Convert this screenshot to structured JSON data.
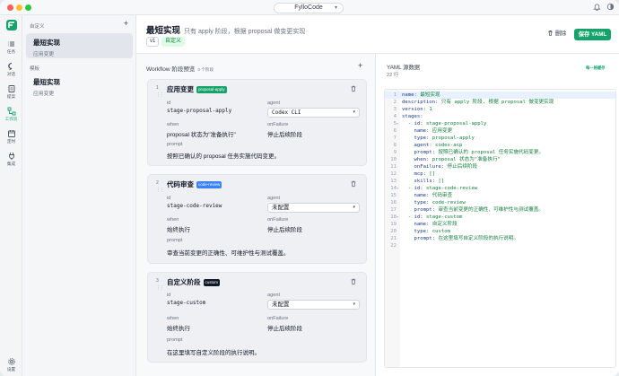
{
  "app": {
    "name": "FylloCode"
  },
  "nav": {
    "items": [
      {
        "label": "任务"
      },
      {
        "label": "对话"
      },
      {
        "label": "提案"
      },
      {
        "label": "工作流"
      },
      {
        "label": "定时"
      },
      {
        "label": "集成"
      }
    ],
    "settings": "设置"
  },
  "sidebar": {
    "custom_header": "自定义",
    "template_header": "模板",
    "custom_items": [
      {
        "name": "最短实现",
        "sub": "应用变更"
      }
    ],
    "template_items": [
      {
        "name": "最短实现",
        "sub": "应用变更"
      }
    ]
  },
  "header": {
    "title": "最短实现",
    "description": "只有 apply 阶段，根据 proposal 做变更实现",
    "version": "v1",
    "custom_badge": "自定义",
    "delete_label": "删除",
    "save_label": "保存 YAML"
  },
  "workflow": {
    "title": "Workflow 阶段预览",
    "count": "3 个阶段",
    "field_labels": {
      "id": "id",
      "agent": "agent",
      "when": "when",
      "on_failure": "onFailure",
      "prompt": "prompt"
    },
    "stages": [
      {
        "num": "1",
        "name": "应用变更",
        "tag": "proposal-apply",
        "id": "stage-proposal-apply",
        "agent": "Codex CLI",
        "when": "proposal 状态为\"准备执行\"",
        "on_failure": "停止后续阶段",
        "prompt": "按照已确认的 proposal 任务实施代码变更。"
      },
      {
        "num": "2",
        "name": "代码审查",
        "tag": "code-review",
        "id": "stage-code-review",
        "agent": "未配置",
        "when": "始终执行",
        "on_failure": "停止后续阶段",
        "prompt": "审查当前变更的正确性、可维护性与测试覆盖。"
      },
      {
        "num": "3",
        "name": "自定义阶段",
        "tag": "custom",
        "id": "stage-custom",
        "agent": "未配置",
        "when": "始终执行",
        "on_failure": "停止后续阶段",
        "prompt": "在这里填写自定义阶段的执行说明。"
      }
    ]
  },
  "yaml": {
    "title": "YAML 源数据",
    "line_count": "22 行",
    "sync_label": "每一格缓存",
    "lines": [
      {
        "n": "1",
        "k": "name",
        "v": "最短实现"
      },
      {
        "n": "2",
        "k": "description",
        "v": "只有 apply 阶段, 根据 proposal 做变更实现"
      },
      {
        "n": "3",
        "k": "version",
        "v": "1"
      },
      {
        "n": "4",
        "k": "stages",
        "v": ""
      },
      {
        "n": "5",
        "k": "id",
        "v": "stage-proposal-apply"
      },
      {
        "n": "6",
        "k": "name",
        "v": "应用变更"
      },
      {
        "n": "7",
        "k": "type",
        "v": "proposal-apply"
      },
      {
        "n": "8",
        "k": "agent",
        "v": "codex-acp"
      },
      {
        "n": "9",
        "k": "prompt",
        "v": "按照已确认的 proposal 任务实施代码变更。"
      },
      {
        "n": "10",
        "k": "when",
        "v": "proposal 状态为\"准备执行\""
      },
      {
        "n": "11",
        "k": "onFailure",
        "v": "停止后续阶段"
      },
      {
        "n": "12",
        "k": "mcp",
        "v": "[]"
      },
      {
        "n": "13",
        "k": "skills",
        "v": "[]"
      },
      {
        "n": "14",
        "k": "id",
        "v": "stage-code-review"
      },
      {
        "n": "15",
        "k": "name",
        "v": "代码审查"
      },
      {
        "n": "16",
        "k": "type",
        "v": "code-review"
      },
      {
        "n": "17",
        "k": "prompt",
        "v": "审查当前变更的正确性、可维护性与测试覆盖。"
      },
      {
        "n": "18",
        "k": "id",
        "v": "stage-custom"
      },
      {
        "n": "19",
        "k": "name",
        "v": "自定义阶段"
      },
      {
        "n": "20",
        "k": "type",
        "v": "custom"
      },
      {
        "n": "21",
        "k": "prompt",
        "v": "在这里填写自定义阶段的执行说明。"
      },
      {
        "n": "22",
        "k": "",
        "v": ""
      }
    ]
  },
  "colors": {
    "accent": "#16a36b",
    "code_review_tag": "#3b82f6",
    "custom_tag": "#111827"
  }
}
